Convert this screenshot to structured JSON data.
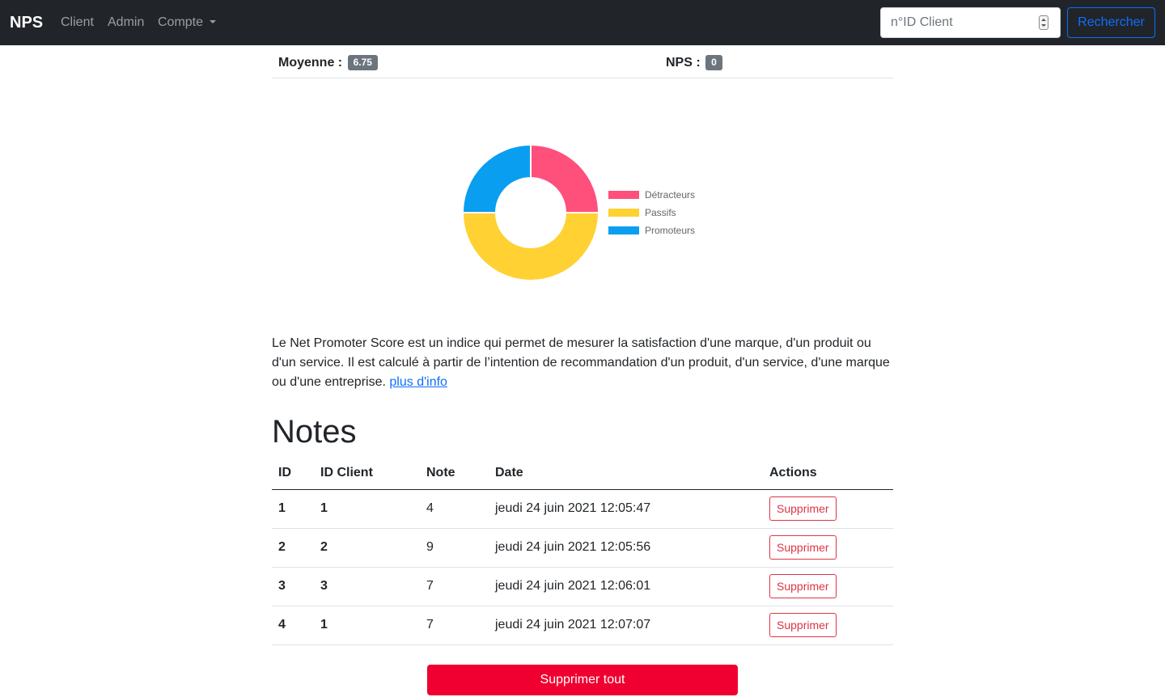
{
  "navbar": {
    "brand": "NPS",
    "links": [
      "Client",
      "Admin",
      "Compte"
    ],
    "search_placeholder": "n°ID Client",
    "search_button": "Rechercher"
  },
  "stats": {
    "moyenne_label": "Moyenne :",
    "moyenne_value": "6.75",
    "nps_label": "NPS :",
    "nps_value": "0"
  },
  "chart_data": {
    "type": "pie",
    "categories": [
      "Détracteurs",
      "Passifs",
      "Promoteurs"
    ],
    "values": [
      1,
      2,
      1
    ],
    "colors": [
      "#ff4f7b",
      "#ffd133",
      "#0a9ef0"
    ],
    "legend": "right"
  },
  "description": {
    "text": "Le Net Promoter Score est un indice qui permet de mesurer la satisfaction d'une marque, d'un produit ou d'un service. Il est calculé à partir de l’intention de recommandation d'un produit, d'un service, d'une marque ou d'une entreprise.",
    "link": "plus d'info"
  },
  "notes": {
    "title": "Notes",
    "headers": [
      "ID",
      "ID Client",
      "Note",
      "Date",
      "Actions"
    ],
    "rows": [
      {
        "id": "1",
        "client": "1",
        "note": "4",
        "date": "jeudi 24 juin 2021 12:05:47",
        "action": "Supprimer"
      },
      {
        "id": "2",
        "client": "2",
        "note": "9",
        "date": "jeudi 24 juin 2021 12:05:56",
        "action": "Supprimer"
      },
      {
        "id": "3",
        "client": "3",
        "note": "7",
        "date": "jeudi 24 juin 2021 12:06:01",
        "action": "Supprimer"
      },
      {
        "id": "4",
        "client": "1",
        "note": "7",
        "date": "jeudi 24 juin 2021 12:07:07",
        "action": "Supprimer"
      }
    ],
    "delete_all": "Supprimer tout"
  }
}
